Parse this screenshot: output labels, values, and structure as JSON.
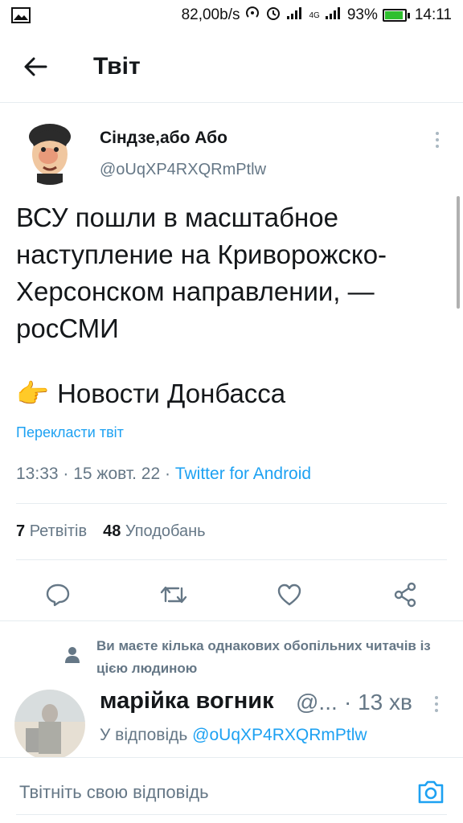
{
  "status_bar": {
    "network_speed": "82,00b/s",
    "signal_4g": "4G",
    "battery_percent": "93%",
    "battery_level": 0.93,
    "time": "14:11"
  },
  "header": {
    "back_icon": "arrow-left-icon",
    "title": "Твіт"
  },
  "tweet": {
    "author_name": "Сіндзе,або Або",
    "author_handle": "@oUqXP4RXQRmPtlw",
    "text": "ВСУ пошли в масштабное наступление на Криворожско-Херсонском направлении, — росСМИ",
    "pointer_emoji": "👉",
    "link_text": "Новости Донбасса",
    "translate_label": "Перекласти твіт",
    "time": "13:33",
    "date": "15 жовт. 22",
    "client": "Twitter for Android",
    "retweets_count": "7",
    "retweets_label": "Ретвітів",
    "likes_count": "48",
    "likes_label": "Уподобань"
  },
  "actions": {
    "reply_icon": "reply-icon",
    "retweet_icon": "retweet-icon",
    "like_icon": "heart-icon",
    "share_icon": "share-icon"
  },
  "suggestion": {
    "text": "Ви маєте кілька однакових обопільних читачів із цією людиною"
  },
  "reply": {
    "name": "марійка вогник",
    "handle": "@...",
    "time_sep": "·",
    "time": "13 хв",
    "reply_to_prefix": "У відповідь",
    "reply_to_handle": "@oUqXP4RXQRmPtlw"
  },
  "compose": {
    "placeholder": "Твітніть свою відповідь",
    "camera_icon": "camera-icon"
  },
  "colors": {
    "accent": "#1da1f2",
    "secondary_text": "#657786",
    "divider": "#e6ecf0"
  }
}
